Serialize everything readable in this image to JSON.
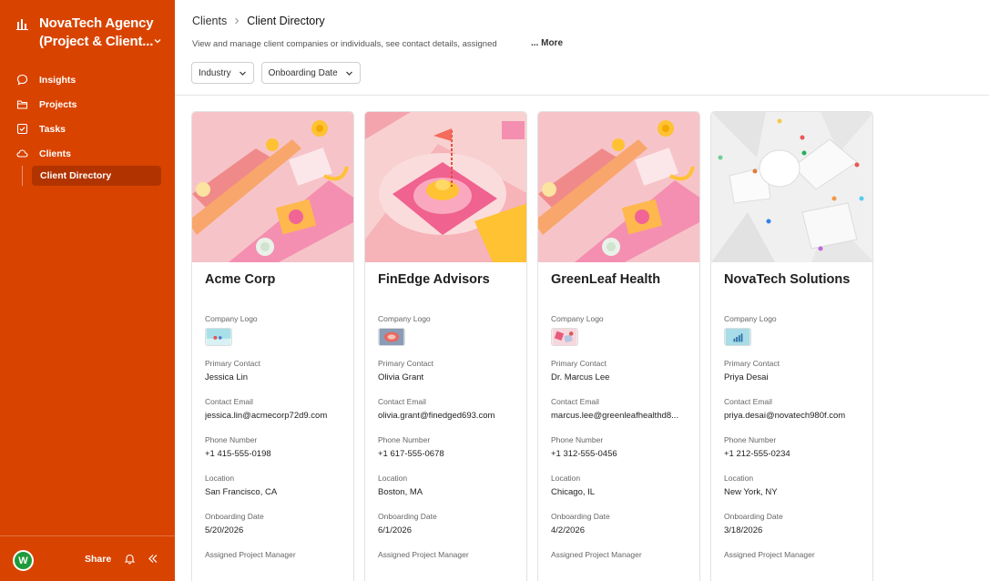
{
  "workspace": {
    "line1": "NovaTech Agency",
    "line2": "(Project & Client..."
  },
  "nav": [
    {
      "label": "Insights",
      "icon": "chat-bubble-icon"
    },
    {
      "label": "Projects",
      "icon": "folder-icon"
    },
    {
      "label": "Tasks",
      "icon": "checkbox-icon"
    },
    {
      "label": "Clients",
      "icon": "cloud-icon"
    }
  ],
  "nav_sub": {
    "label": "Client Directory"
  },
  "footer": {
    "avatar": "W",
    "share": "Share"
  },
  "breadcrumb": {
    "parent": "Clients",
    "current": "Client Directory"
  },
  "description": "View and manage client companies or individuals, see contact details, assigned",
  "more_label": "... More",
  "filters": [
    "Industry",
    "Onboarding Date"
  ],
  "field_labels": {
    "logo": "Company Logo",
    "contact": "Primary Contact",
    "email": "Contact Email",
    "phone": "Phone Number",
    "location": "Location",
    "onboarding": "Onboarding Date",
    "manager": "Assigned Project Manager"
  },
  "clients": [
    {
      "name": "Acme Corp",
      "contact": "Jessica Lin",
      "email": "jessica.lin@acmecorp72d9.com",
      "phone": "+1 415-555-0198",
      "location": "San Francisco, CA",
      "onboarding": "5/20/2026"
    },
    {
      "name": "FinEdge Advisors",
      "contact": "Olivia Grant",
      "email": "olivia.grant@finedged693.com",
      "phone": "+1 617-555-0678",
      "location": "Boston, MA",
      "onboarding": "6/1/2026"
    },
    {
      "name": "GreenLeaf Health",
      "contact": "Dr. Marcus Lee",
      "email": "marcus.lee@greenleafhealthd8...",
      "phone": "+1 312-555-0456",
      "location": "Chicago, IL",
      "onboarding": "4/2/2026"
    },
    {
      "name": "NovaTech Solutions",
      "contact": "Priya Desai",
      "email": "priya.desai@novatech980f.com",
      "phone": "+1 212-555-0234",
      "location": "New York, NY",
      "onboarding": "3/18/2026"
    }
  ],
  "colors": {
    "sidebar": "#d94300",
    "sidebar_active": "#b13400",
    "avatar": "#1f9a3a"
  }
}
